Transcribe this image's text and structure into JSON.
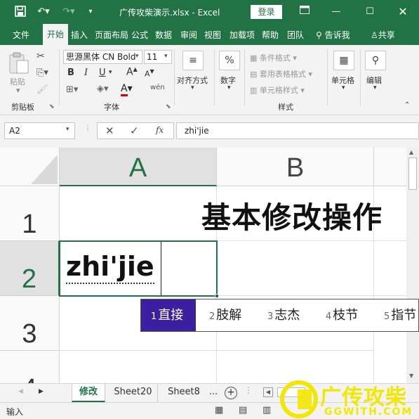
{
  "titlebar": {
    "doc_title": "广传攻柴演示.xlsx  -  Excel",
    "login": "登录",
    "save_icon": "save-icon",
    "undo_icon": "undo-icon",
    "redo_icon": "redo-icon"
  },
  "menu": {
    "items": [
      "文件",
      "开始",
      "插入",
      "页面布局",
      "公式",
      "数据",
      "审阅",
      "视图",
      "加载项",
      "帮助",
      "团队"
    ],
    "tell_me": "告诉我",
    "share": "共享"
  },
  "ribbon": {
    "clipboard": {
      "paste": "粘贴",
      "group": "剪贴板"
    },
    "font": {
      "name": "思源黑体 CN Bold",
      "size": "11",
      "bold": "B",
      "italic": "I",
      "underline": "U",
      "font_color_label": "A",
      "group": "字体"
    },
    "alignment": {
      "label": "对齐方式"
    },
    "number": {
      "label": "数字",
      "symbol": "%"
    },
    "styles": {
      "conditional": "条件格式",
      "table": "套用表格格式",
      "cell_styles": "单元格样式",
      "group": "样式"
    },
    "cells": {
      "label": "单元格"
    },
    "editing": {
      "label": "编辑"
    }
  },
  "formula_bar": {
    "name_box": "A2",
    "fx": "fx",
    "value": "zhi'jie"
  },
  "grid": {
    "columns": [
      "A",
      "B"
    ],
    "rows": [
      "1",
      "2",
      "3",
      "4"
    ],
    "b1": "基本修改操作",
    "a2": "zhi'jie"
  },
  "ime": {
    "candidates": [
      {
        "n": "1",
        "text": "直接"
      },
      {
        "n": "2",
        "text": "肢解"
      },
      {
        "n": "3",
        "text": "志杰"
      },
      {
        "n": "4",
        "text": "枝节"
      },
      {
        "n": "5",
        "text": "指节"
      }
    ]
  },
  "sheets": {
    "tabs": [
      "修改",
      "Sheet20",
      "Sheet8"
    ],
    "more": "...",
    "active": "修改"
  },
  "status": {
    "mode": "输入"
  },
  "watermark": {
    "text": "广传攻柴",
    "url": "GGWITH.COM"
  },
  "colors": {
    "excel_green": "#217346",
    "ime_highlight": "#3c1f9e"
  }
}
